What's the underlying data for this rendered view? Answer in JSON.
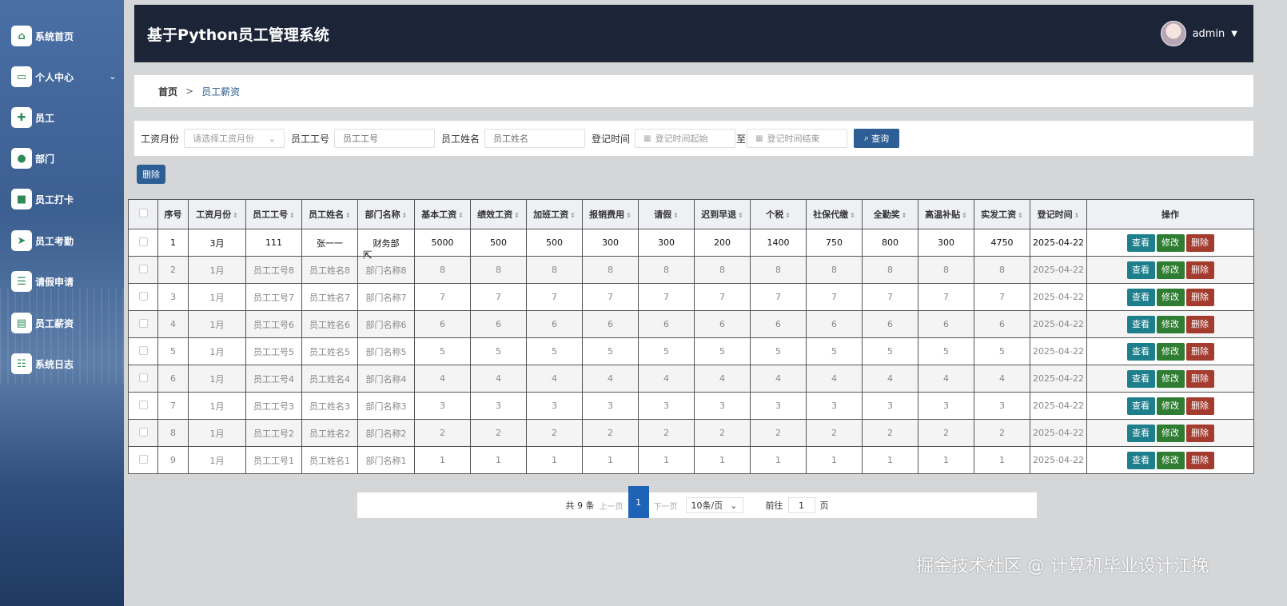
{
  "sidebar": {
    "items": [
      {
        "label": "系统首页",
        "icon": "home-icon"
      },
      {
        "label": "个人中心",
        "icon": "card-icon",
        "expandable": true
      },
      {
        "label": "员工",
        "icon": "puzzle-icon"
      },
      {
        "label": "部门",
        "icon": "user-icon"
      },
      {
        "label": "员工打卡",
        "icon": "briefcase-icon"
      },
      {
        "label": "员工考勤",
        "icon": "send-icon"
      },
      {
        "label": "请假申请",
        "icon": "list-icon"
      },
      {
        "label": "员工薪资",
        "icon": "clipboard-icon"
      },
      {
        "label": "系统日志",
        "icon": "sliders-icon"
      }
    ]
  },
  "header": {
    "title": "基于Python员工管理系统",
    "user": "admin"
  },
  "breadcrumb": {
    "home": "首页",
    "sep": ">",
    "current": "员工薪资"
  },
  "search": {
    "month_label": "工资月份",
    "month_placeholder": "请选择工资月份",
    "emp_no_label": "员工工号",
    "emp_no_placeholder": "员工工号",
    "emp_name_label": "员工姓名",
    "emp_name_placeholder": "员工姓名",
    "time_label": "登记时间",
    "start_placeholder": "登记时间起始",
    "to": "至",
    "end_placeholder": "登记时间结束",
    "query_btn": "查询"
  },
  "toolbar": {
    "delete_btn": "删除"
  },
  "table": {
    "headers": [
      "序号",
      "工资月份",
      "员工工号",
      "员工姓名",
      "部门名称",
      "基本工资",
      "绩效工资",
      "加班工资",
      "报销费用",
      "请假",
      "迟到早退",
      "个税",
      "社保代缴",
      "全勤奖",
      "高温补贴",
      "实发工资",
      "登记时间",
      "操作"
    ],
    "rows": [
      [
        "1",
        "3月",
        "111",
        "张一一",
        "财务部",
        "5000",
        "500",
        "500",
        "300",
        "300",
        "200",
        "1400",
        "750",
        "800",
        "300",
        "4750",
        "2025-04-22"
      ],
      [
        "2",
        "1月",
        "员工工号8",
        "员工姓名8",
        "部门名称8",
        "8",
        "8",
        "8",
        "8",
        "8",
        "8",
        "8",
        "8",
        "8",
        "8",
        "8",
        "2025-04-22"
      ],
      [
        "3",
        "1月",
        "员工工号7",
        "员工姓名7",
        "部门名称7",
        "7",
        "7",
        "7",
        "7",
        "7",
        "7",
        "7",
        "7",
        "7",
        "7",
        "7",
        "2025-04-22"
      ],
      [
        "4",
        "1月",
        "员工工号6",
        "员工姓名6",
        "部门名称6",
        "6",
        "6",
        "6",
        "6",
        "6",
        "6",
        "6",
        "6",
        "6",
        "6",
        "6",
        "2025-04-22"
      ],
      [
        "5",
        "1月",
        "员工工号5",
        "员工姓名5",
        "部门名称5",
        "5",
        "5",
        "5",
        "5",
        "5",
        "5",
        "5",
        "5",
        "5",
        "5",
        "5",
        "2025-04-22"
      ],
      [
        "6",
        "1月",
        "员工工号4",
        "员工姓名4",
        "部门名称4",
        "4",
        "4",
        "4",
        "4",
        "4",
        "4",
        "4",
        "4",
        "4",
        "4",
        "4",
        "2025-04-22"
      ],
      [
        "7",
        "1月",
        "员工工号3",
        "员工姓名3",
        "部门名称3",
        "3",
        "3",
        "3",
        "3",
        "3",
        "3",
        "3",
        "3",
        "3",
        "3",
        "3",
        "2025-04-22"
      ],
      [
        "8",
        "1月",
        "员工工号2",
        "员工姓名2",
        "部门名称2",
        "2",
        "2",
        "2",
        "2",
        "2",
        "2",
        "2",
        "2",
        "2",
        "2",
        "2",
        "2025-04-22"
      ],
      [
        "9",
        "1月",
        "员工工号1",
        "员工姓名1",
        "部门名称1",
        "1",
        "1",
        "1",
        "1",
        "1",
        "1",
        "1",
        "1",
        "1",
        "1",
        "1",
        "2025-04-22"
      ]
    ],
    "actions": {
      "view": "查看",
      "edit": "修改",
      "delete": "删除"
    }
  },
  "pager": {
    "total": "共 9 条",
    "prev": "上一页",
    "current": "1",
    "next": "下一页",
    "size": "10条/页",
    "goto": "前往",
    "goto_value": "1",
    "page_unit": "页"
  },
  "watermark": "掘金技术社区 @ 计算机毕业设计江挽",
  "colors": {
    "primary": "#2d5f96",
    "view": "#1e7f8c",
    "edit": "#2e7d32",
    "delete": "#a33b2f",
    "header_bg": "#1c2538"
  }
}
